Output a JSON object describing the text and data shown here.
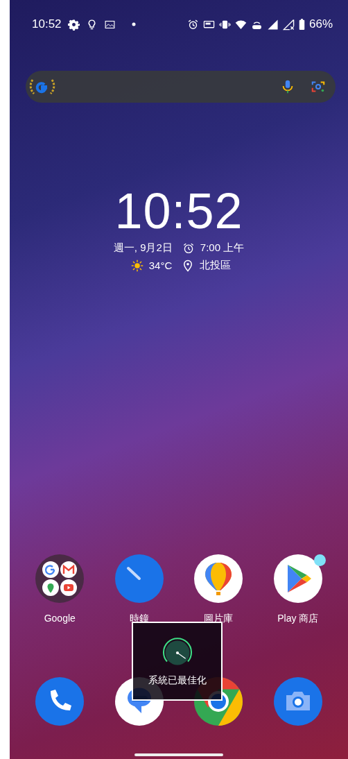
{
  "status_bar": {
    "time": "10:52",
    "battery": "66%"
  },
  "clock_widget": {
    "time": "10:52",
    "date": "週一, 9月2日",
    "alarm": "7:00 上午",
    "temperature": "34°C",
    "location": "北投區"
  },
  "apps": [
    {
      "kind": "folder",
      "label": "Google",
      "badge": false
    },
    {
      "kind": "clock",
      "label": "時鐘",
      "badge": false
    },
    {
      "kind": "gallery",
      "label": "圖片庫",
      "badge": false
    },
    {
      "kind": "store",
      "label": "Play 商店",
      "badge": true
    }
  ],
  "dock": [
    {
      "kind": "phone"
    },
    {
      "kind": "messages"
    },
    {
      "kind": "browser"
    },
    {
      "kind": "camera"
    }
  ],
  "toast": {
    "text": "系統已最佳化"
  }
}
